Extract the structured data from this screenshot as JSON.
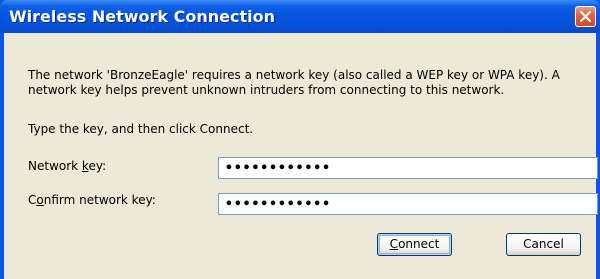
{
  "window": {
    "title": "Wireless Network Connection",
    "close_icon": "close-icon",
    "colors": {
      "titlebar": "#0454e0",
      "close": "#e2643f",
      "client": "#ece9d8"
    }
  },
  "message": {
    "line1": "The network 'BronzeEagle' requires a network key (also called a WEP key or WPA key). A",
    "line2": "network key helps prevent unknown intruders from connecting to this network.",
    "instruction": "Type the key, and then click Connect."
  },
  "fields": {
    "network_key": {
      "label_pre": "Network ",
      "label_ul": "k",
      "label_post": "ey:",
      "value": "••••••••••••"
    },
    "confirm_key": {
      "label_pre": "C",
      "label_ul": "o",
      "label_post": "nfirm network key:",
      "value": "••••••••••••"
    }
  },
  "buttons": {
    "connect": {
      "ul": "C",
      "rest": "onnect"
    },
    "cancel": "Cancel"
  }
}
